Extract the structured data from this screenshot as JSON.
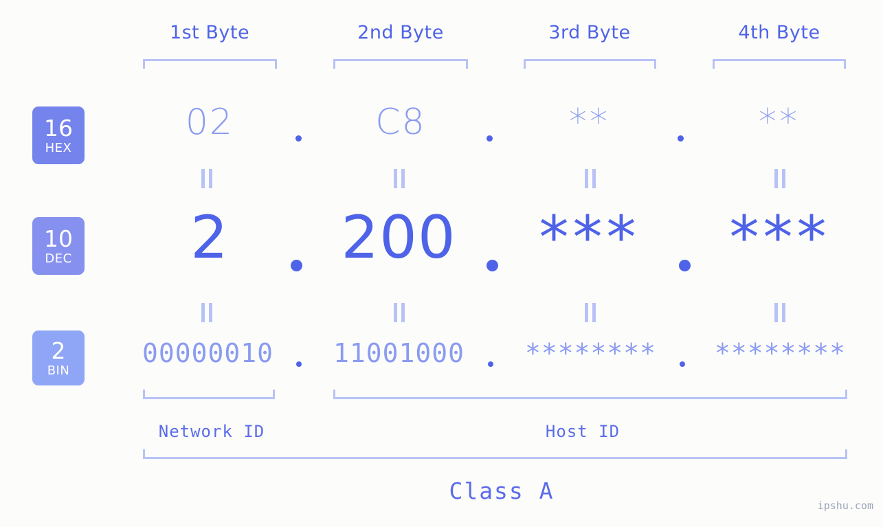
{
  "meta": {
    "watermark": "ipshu.com",
    "background_color": "#fcfdfa",
    "accent_dark": "#4f63e8",
    "accent_mid": "#8b9bf2",
    "accent_light": "#b8c2f7"
  },
  "columns": [
    {
      "header": "1st Byte"
    },
    {
      "header": "2nd Byte"
    },
    {
      "header": "3rd Byte"
    },
    {
      "header": "4th Byte"
    }
  ],
  "rows": [
    {
      "badge_number": "16",
      "badge_name": "HEX",
      "badge_color": "#7583ec",
      "values": [
        "02",
        "C8",
        "**",
        "**"
      ],
      "separator": "."
    },
    {
      "badge_number": "10",
      "badge_name": "DEC",
      "badge_color": "#8690ee",
      "values": [
        "2",
        "200",
        "***",
        "***"
      ],
      "separator": "."
    },
    {
      "badge_number": "2",
      "badge_name": "BIN",
      "badge_color": "#8fa5f6",
      "values": [
        "00000010",
        "11001000",
        "********",
        "********"
      ],
      "separator": "."
    }
  ],
  "equals_marks": {
    "symbol": "||",
    "count_per_row": 4
  },
  "footer": {
    "network_id_label": "Network ID",
    "host_id_label": "Host ID",
    "class_label": "Class A"
  }
}
